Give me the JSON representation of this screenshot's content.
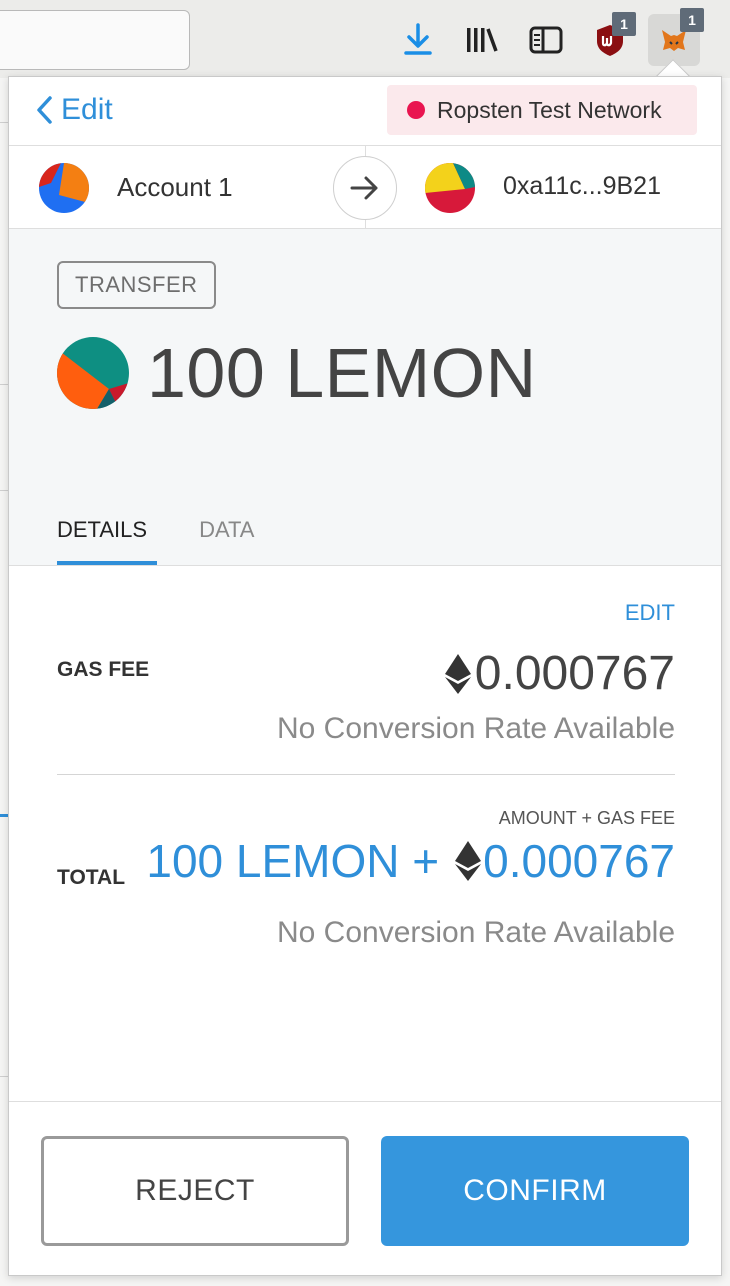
{
  "browser": {
    "ublock_badge": "1",
    "metamask_badge": "1"
  },
  "header": {
    "back_label": "Edit",
    "network_label": "Ropsten Test Network",
    "network_color": "#e91550"
  },
  "accounts": {
    "from_name": "Account 1",
    "to_address": "0xa11c...9B21"
  },
  "summary": {
    "action_badge": "TRANSFER",
    "amount": "100 LEMON"
  },
  "tabs": [
    {
      "label": "DETAILS",
      "active": true
    },
    {
      "label": "DATA",
      "active": false
    }
  ],
  "details": {
    "edit_label": "EDIT",
    "gas_fee_label": "GAS FEE",
    "gas_fee_value": "0.000767",
    "gas_fee_conversion": "No Conversion Rate Available",
    "total_caption": "AMOUNT + GAS FEE",
    "total_label": "TOTAL",
    "total_token_part": "100 LEMON +",
    "total_eth_value": "0.000767",
    "total_conversion": "No Conversion Rate Available"
  },
  "footer": {
    "reject_label": "REJECT",
    "confirm_label": "CONFIRM"
  },
  "colors": {
    "accent": "#2f8fd9",
    "confirm": "#3596dd"
  }
}
